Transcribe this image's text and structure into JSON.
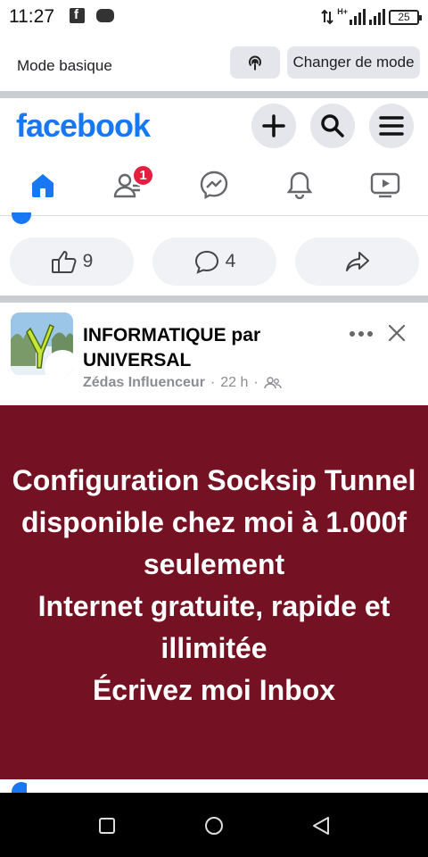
{
  "status_bar": {
    "time": "11:27",
    "battery": "25",
    "network": "H+"
  },
  "mode_bar": {
    "label": "Mode basique",
    "switch_button": "Changer de mode"
  },
  "header": {
    "logo": "facebook"
  },
  "nav": {
    "tabs": [
      "home",
      "friends",
      "messenger",
      "notifications",
      "watch"
    ],
    "friends_badge": "1"
  },
  "previous_post": {
    "likes": "9",
    "comments": "4"
  },
  "post": {
    "author": "INFORMATIQUE  par UNIVERSAL",
    "badge_label": "Zédas Influenceur",
    "time": "22 h",
    "banner_text": "Configuration Socksip Tunnel disponible chez moi à 1.000f seulement\nInternet gratuite, rapide et illimitée\nÉcrivez moi Inbox",
    "banner_color": "#741122"
  },
  "colors": {
    "brand": "#1877f2",
    "badge": "#e41e3f"
  }
}
